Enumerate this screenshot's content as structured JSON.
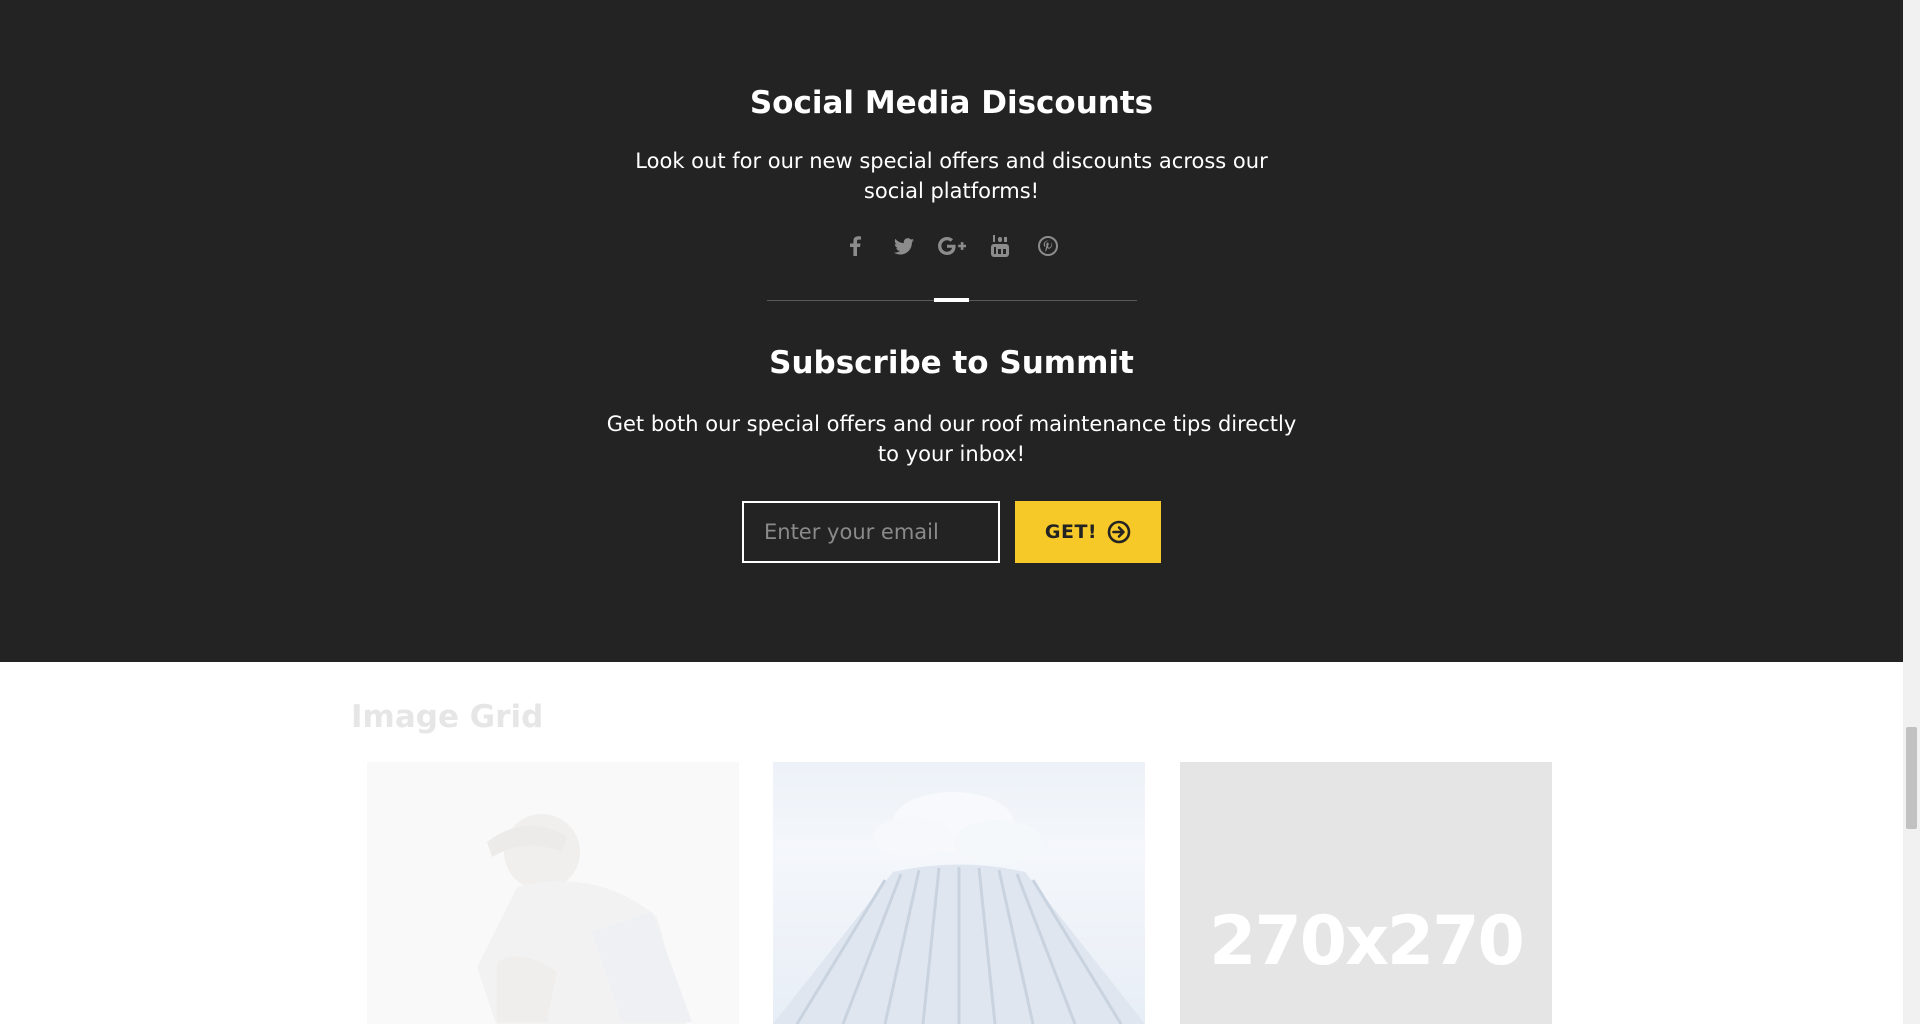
{
  "social": {
    "title": "Social Media Discounts",
    "subtitle_line1": "Look out for our new special offers and discounts across our",
    "subtitle_line2": "social platforms!",
    "icons": [
      "facebook-icon",
      "twitter-icon",
      "google-plus-icon",
      "youtube-icon",
      "pinterest-icon"
    ]
  },
  "subscribe": {
    "title": "Subscribe to Summit",
    "subtitle_line1": "Get both our special offers and our roof maintenance tips directly",
    "subtitle_line2": "to your inbox!",
    "email_placeholder": "Enter your email",
    "email_value": "",
    "button_label": "GET!"
  },
  "image_grid": {
    "title": "Image Grid",
    "placeholder_label": "270x270"
  },
  "colors": {
    "dark_bg": "#232323",
    "accent": "#f6c928",
    "icon_gray": "#8c8c8c"
  }
}
